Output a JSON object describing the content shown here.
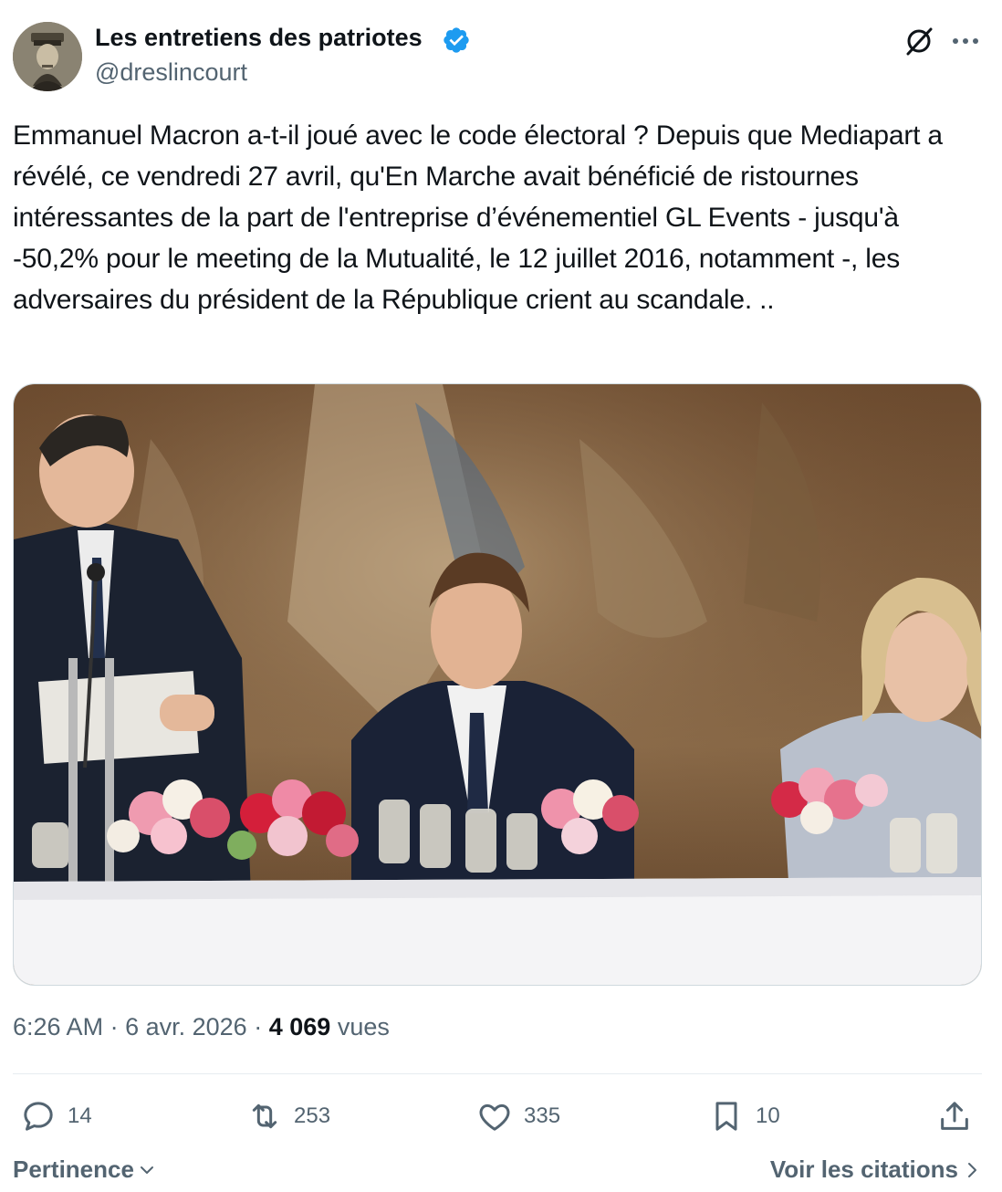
{
  "author": {
    "name": "Les entretiens des patriotes",
    "handle": "@dreslincourt",
    "avatar_icon": "avatar-portrait",
    "verified_color": "#1d9bf0"
  },
  "header_icons": [
    "grok-icon",
    "more-icon"
  ],
  "tweet": {
    "text": "Emmanuel Macron a-t-il joué avec le code électoral ? Depuis que Mediapart a révélé, ce vendredi 27 avril, qu'En Marche avait bénéficié de ristournes intéressantes de la part de l'entreprise d’événementiel GL Events - jusqu'à -50,2% pour le meeting de la Mutualité, le 12 juillet 2016, notamment -, les adversaires du président de la République crient au scandale. .."
  },
  "meta": {
    "time": "6:26 AM",
    "separator": "·",
    "date": "6 avr. 2026",
    "views_count": "4 069",
    "views_label": "vues"
  },
  "actions": {
    "replies": "14",
    "reposts": "253",
    "likes": "335",
    "bookmarks": "10"
  },
  "footer": {
    "sort_label": "Pertinence",
    "quotes_label": "Voir les citations"
  },
  "colors": {
    "text_primary": "#0f1419",
    "text_secondary": "#536471",
    "accent": "#1d9bf0",
    "divider": "#e6ecf0"
  }
}
